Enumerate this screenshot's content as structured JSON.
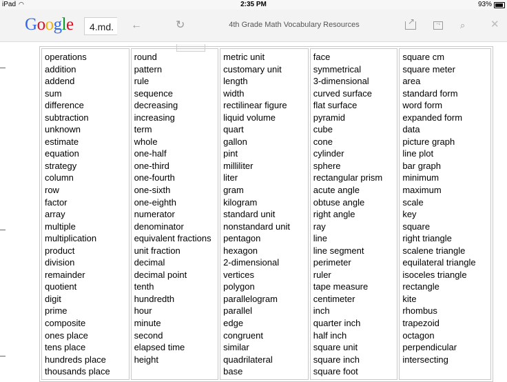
{
  "status_bar": {
    "device": "iPad",
    "time": "2:35 PM",
    "battery": "93%"
  },
  "browser": {
    "url": "4.md.",
    "page_title": "4th Grade Math Vocabulary Resources",
    "logo": {
      "letters": [
        "G",
        "o",
        "o",
        "g",
        "l",
        "e"
      ]
    }
  },
  "columns": [
    [
      "operations",
      "addition",
      "addend",
      "sum",
      "difference",
      "subtraction",
      "unknown",
      "estimate",
      "equation",
      "strategy",
      "column",
      "row",
      "factor",
      "array",
      "multiple",
      "multiplication",
      "product",
      "division",
      "remainder",
      "quotient",
      "digit",
      "prime",
      "composite",
      "ones place",
      "tens place",
      "hundreds place",
      "thousands place"
    ],
    [
      "round",
      "pattern",
      "rule",
      "sequence",
      "decreasing",
      "increasing",
      "term",
      "whole",
      "one-half",
      "one-third",
      "one-fourth",
      "one-sixth",
      "one-eighth",
      "numerator",
      "denominator",
      "equivalent fractions",
      "unit fraction",
      "decimal",
      "decimal point",
      "tenth",
      "hundredth",
      "hour",
      "minute",
      "second",
      "elapsed time",
      "height"
    ],
    [
      "metric unit",
      "customary unit",
      "length",
      "width",
      "rectilinear figure",
      "liquid volume",
      "quart",
      "gallon",
      "pint",
      "milliliter",
      "liter",
      "gram",
      "kilogram",
      "standard unit",
      "nonstandard unit",
      "pentagon",
      "hexagon",
      "2-dimensional",
      "vertices",
      "polygon",
      "parallelogram",
      "parallel",
      "edge",
      "congruent",
      "similar",
      "quadrilateral",
      "base"
    ],
    [
      "face",
      "symmetrical",
      "3-dimensional",
      "curved surface",
      "flat surface",
      "pyramid",
      "cube",
      "cone",
      "cylinder",
      "sphere",
      "rectangular prism",
      "acute angle",
      "obtuse angle",
      "right angle",
      "ray",
      "line",
      "line segment",
      "perimeter",
      "ruler",
      "tape measure",
      "centimeter",
      "inch",
      "quarter inch",
      "half inch",
      "square unit",
      "square inch",
      "square foot"
    ],
    [
      "square cm",
      "square meter",
      "area",
      "standard form",
      "word form",
      "expanded form",
      "data",
      "picture graph",
      "line plot",
      "bar graph",
      "minimum",
      "maximum",
      "scale",
      "key",
      "square",
      "right triangle",
      "scalene triangle",
      "equilateral triangle",
      "isoceles triangle",
      "rectangle",
      "kite",
      "rhombus",
      "trapezoid",
      "octagon",
      "perpendicular",
      "intersecting"
    ]
  ]
}
